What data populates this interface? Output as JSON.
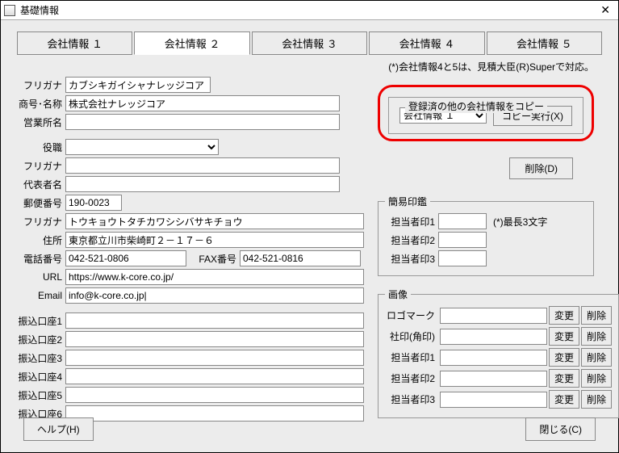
{
  "window": {
    "title": "基礎情報"
  },
  "tabs": [
    "会社情報 １",
    "会社情報 ２",
    "会社情報 ３",
    "会社情報 ４",
    "会社情報 ５"
  ],
  "note": "(*)会社情報4と5は、見積大臣(R)Superで対応。",
  "labels": {
    "furigana": "フリガナ",
    "shougou": "商号･名称",
    "eigyousho": "営業所名",
    "yakushoku": "役職",
    "daihyou": "代表者名",
    "yuubin": "郵便番号",
    "juusho": "住所",
    "tel": "電話番号",
    "fax": "FAX番号",
    "url": "URL",
    "email": "Email",
    "furikomi1": "振込口座1",
    "furikomi2": "振込口座2",
    "furikomi3": "振込口座3",
    "furikomi4": "振込口座4",
    "furikomi5": "振込口座5",
    "furikomi6": "振込口座6"
  },
  "values": {
    "furigana1": "カブシキガイシャナレッジコア",
    "shougou": "株式会社ナレッジコア",
    "eigyousho": "",
    "yakushoku": "",
    "furigana2": "",
    "daihyou": "",
    "yuubin": "190-0023",
    "addr_furigana": "トウキョウトタチカワシシバサキチョウ",
    "juusho": "東京都立川市柴崎町２－１７－６",
    "tel": "042-521-0806",
    "fax": "042-521-0816",
    "url": "https://www.k-core.co.jp/",
    "email": "info@k-core.co.jp|",
    "furikomi1": "",
    "furikomi2": "",
    "furikomi3": "",
    "furikomi4": "",
    "furikomi5": "",
    "furikomi6": ""
  },
  "copy": {
    "legend": "登録済の他の会社情報をコピー",
    "select": "会社情報 １",
    "button": "コピー実行(X)"
  },
  "delete_btn": "削除(D)",
  "stamp": {
    "legend": "簡易印鑑",
    "lbl1": "担当者印1",
    "lbl2": "担当者印2",
    "lbl3": "担当者印3",
    "note": "(*)最長3文字"
  },
  "image": {
    "legend": "画像",
    "logo": "ロゴマーク",
    "shain": "社印(角印)",
    "t1": "担当者印1",
    "t2": "担当者印2",
    "t3": "担当者印3",
    "change": "変更",
    "del": "削除"
  },
  "footer": {
    "help": "ヘルプ(H)",
    "close": "閉じる(C)"
  }
}
